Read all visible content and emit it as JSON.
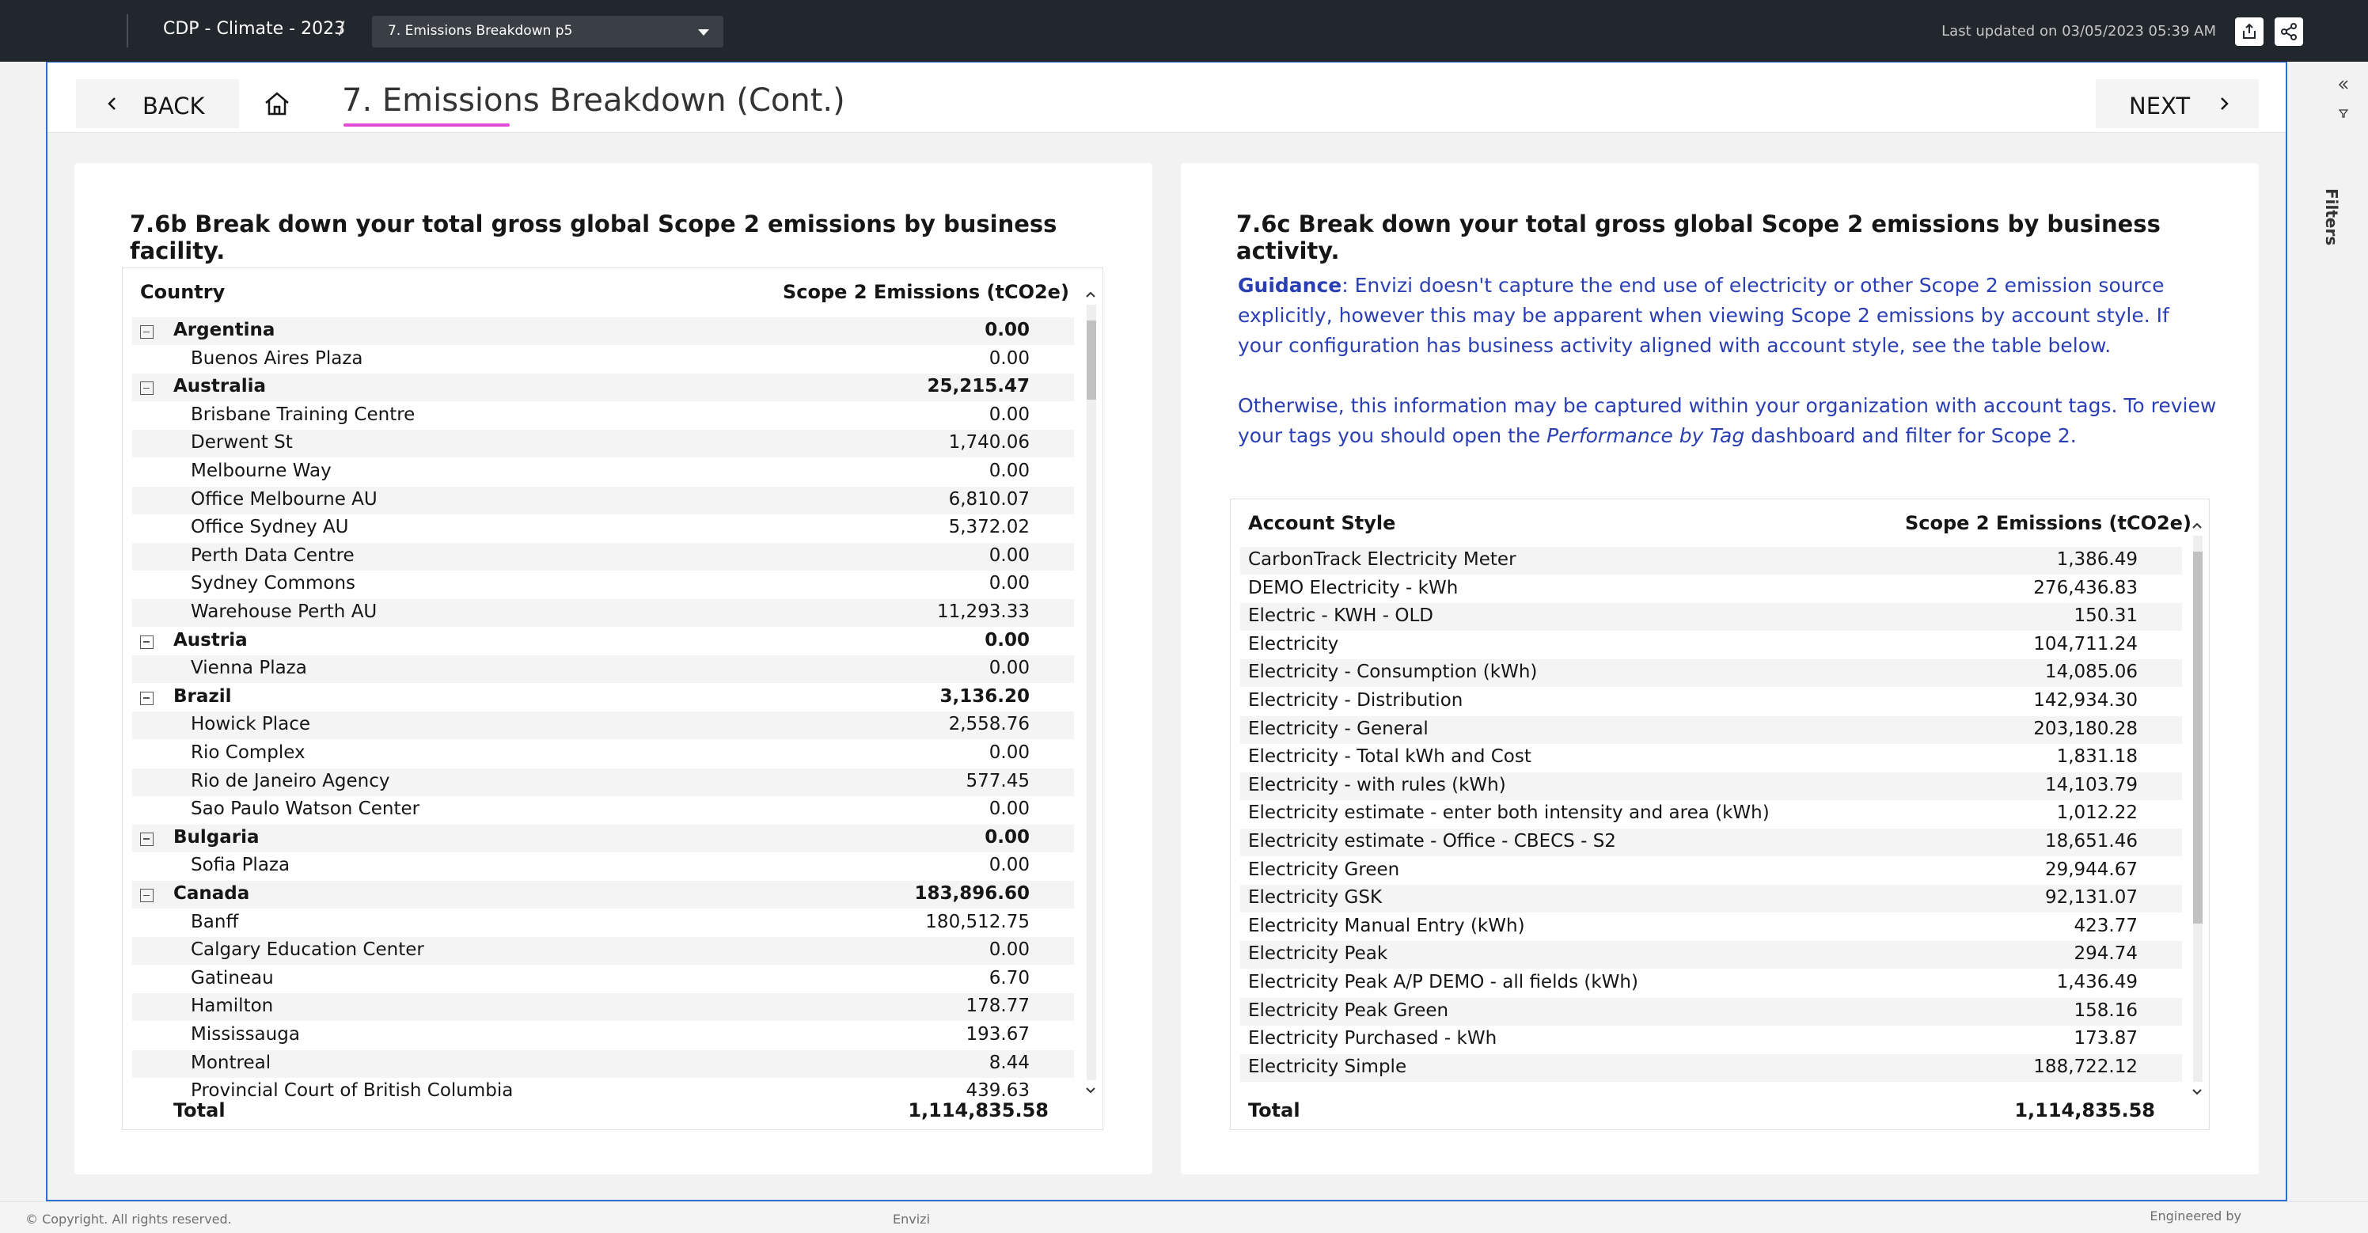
{
  "topbar": {
    "breadcrumb": "CDP - Climate - 2023",
    "separator": "/",
    "page_select": "7. Emissions Breakdown p5",
    "last_updated": "Last updated on 03/05/2023 05:39 AM"
  },
  "header": {
    "back_label": "BACK",
    "next_label": "NEXT",
    "title": "7. Emissions Breakdown (Cont.)"
  },
  "left": {
    "heading": "7.6b Break down your total gross global Scope 2 emissions by business facility.",
    "col1": "Country",
    "col2": "Scope 2 Emissions (tCO2e)",
    "rows": [
      {
        "name": "Argentina",
        "value": "0.00",
        "group": true
      },
      {
        "name": "Buenos Aires Plaza",
        "value": "0.00"
      },
      {
        "name": "Australia",
        "value": "25,215.47",
        "group": true
      },
      {
        "name": "Brisbane Training Centre",
        "value": "0.00"
      },
      {
        "name": "Derwent St",
        "value": "1,740.06"
      },
      {
        "name": "Melbourne Way",
        "value": "0.00"
      },
      {
        "name": "Office Melbourne AU",
        "value": "6,810.07"
      },
      {
        "name": "Office Sydney AU",
        "value": "5,372.02"
      },
      {
        "name": "Perth Data Centre",
        "value": "0.00"
      },
      {
        "name": "Sydney Commons",
        "value": "0.00"
      },
      {
        "name": "Warehouse Perth AU",
        "value": "11,293.33"
      },
      {
        "name": "Austria",
        "value": "0.00",
        "group": true
      },
      {
        "name": "Vienna Plaza",
        "value": "0.00"
      },
      {
        "name": "Brazil",
        "value": "3,136.20",
        "group": true
      },
      {
        "name": "Howick Place",
        "value": "2,558.76"
      },
      {
        "name": "Rio Complex",
        "value": "0.00"
      },
      {
        "name": "Rio de Janeiro Agency",
        "value": "577.45"
      },
      {
        "name": "Sao Paulo Watson Center",
        "value": "0.00"
      },
      {
        "name": "Bulgaria",
        "value": "0.00",
        "group": true
      },
      {
        "name": "Sofia Plaza",
        "value": "0.00"
      },
      {
        "name": "Canada",
        "value": "183,896.60",
        "group": true
      },
      {
        "name": "Banff",
        "value": "180,512.75"
      },
      {
        "name": "Calgary Education Center",
        "value": "0.00"
      },
      {
        "name": "Gatineau",
        "value": "6.70"
      },
      {
        "name": "Hamilton",
        "value": "178.77"
      },
      {
        "name": "Mississauga",
        "value": "193.67"
      },
      {
        "name": "Montreal",
        "value": "8.44"
      },
      {
        "name": "Provincial Court of British Columbia",
        "value": "439.63"
      }
    ],
    "total_label": "Total",
    "total_value": "1,114,835.58"
  },
  "right": {
    "heading": "7.6c Break down your total gross global Scope 2 emissions by business activity.",
    "guidance_label": "Guidance",
    "guidance_text": ": Envizi doesn't capture the end use of electricity or other Scope 2 emission source explicitly, however this may be apparent when viewing Scope 2 emissions by account style. If your configuration has business activity aligned with account style, see the table below.",
    "otherwise_text_1": "Otherwise, this information may be captured within your organization with account tags. To review your tags you should open the ",
    "otherwise_link": "Performance by Tag",
    "otherwise_text_2": " dashboard and filter for Scope 2.",
    "col1": "Account Style",
    "col2": "Scope 2 Emissions (tCO2e)",
    "rows": [
      {
        "name": "CarbonTrack Electricity Meter",
        "value": "1,386.49"
      },
      {
        "name": "DEMO Electricity - kWh",
        "value": "276,436.83"
      },
      {
        "name": "Electric - KWH - OLD",
        "value": "150.31"
      },
      {
        "name": "Electricity",
        "value": "104,711.24"
      },
      {
        "name": "Electricity - Consumption (kWh)",
        "value": "14,085.06"
      },
      {
        "name": "Electricity - Distribution",
        "value": "142,934.30"
      },
      {
        "name": "Electricity - General",
        "value": "203,180.28"
      },
      {
        "name": "Electricity - Total kWh and Cost",
        "value": "1,831.18"
      },
      {
        "name": "Electricity - with rules (kWh)",
        "value": "14,103.79"
      },
      {
        "name": "Electricity estimate - enter both intensity and area (kWh)",
        "value": "1,012.22"
      },
      {
        "name": "Electricity estimate - Office - CBECS - S2",
        "value": "18,651.46"
      },
      {
        "name": "Electricity Green",
        "value": "29,944.67"
      },
      {
        "name": "Electricity GSK",
        "value": "92,131.07"
      },
      {
        "name": "Electricity Manual Entry (kWh)",
        "value": "423.77"
      },
      {
        "name": "Electricity Peak",
        "value": "294.74"
      },
      {
        "name": "Electricity Peak A/P DEMO - all fields (kWh)",
        "value": "1,436.49"
      },
      {
        "name": "Electricity Peak Green",
        "value": "158.16"
      },
      {
        "name": "Electricity Purchased - kWh",
        "value": "173.87"
      },
      {
        "name": "Electricity Simple",
        "value": "188,722.12"
      }
    ],
    "total_label": "Total",
    "total_value": "1,114,835.58"
  },
  "rail": {
    "filters_label": "Filters"
  },
  "footer": {
    "copyright": "© Copyright. All rights reserved.",
    "brand": "Envizi",
    "engineered": "Engineered by"
  }
}
